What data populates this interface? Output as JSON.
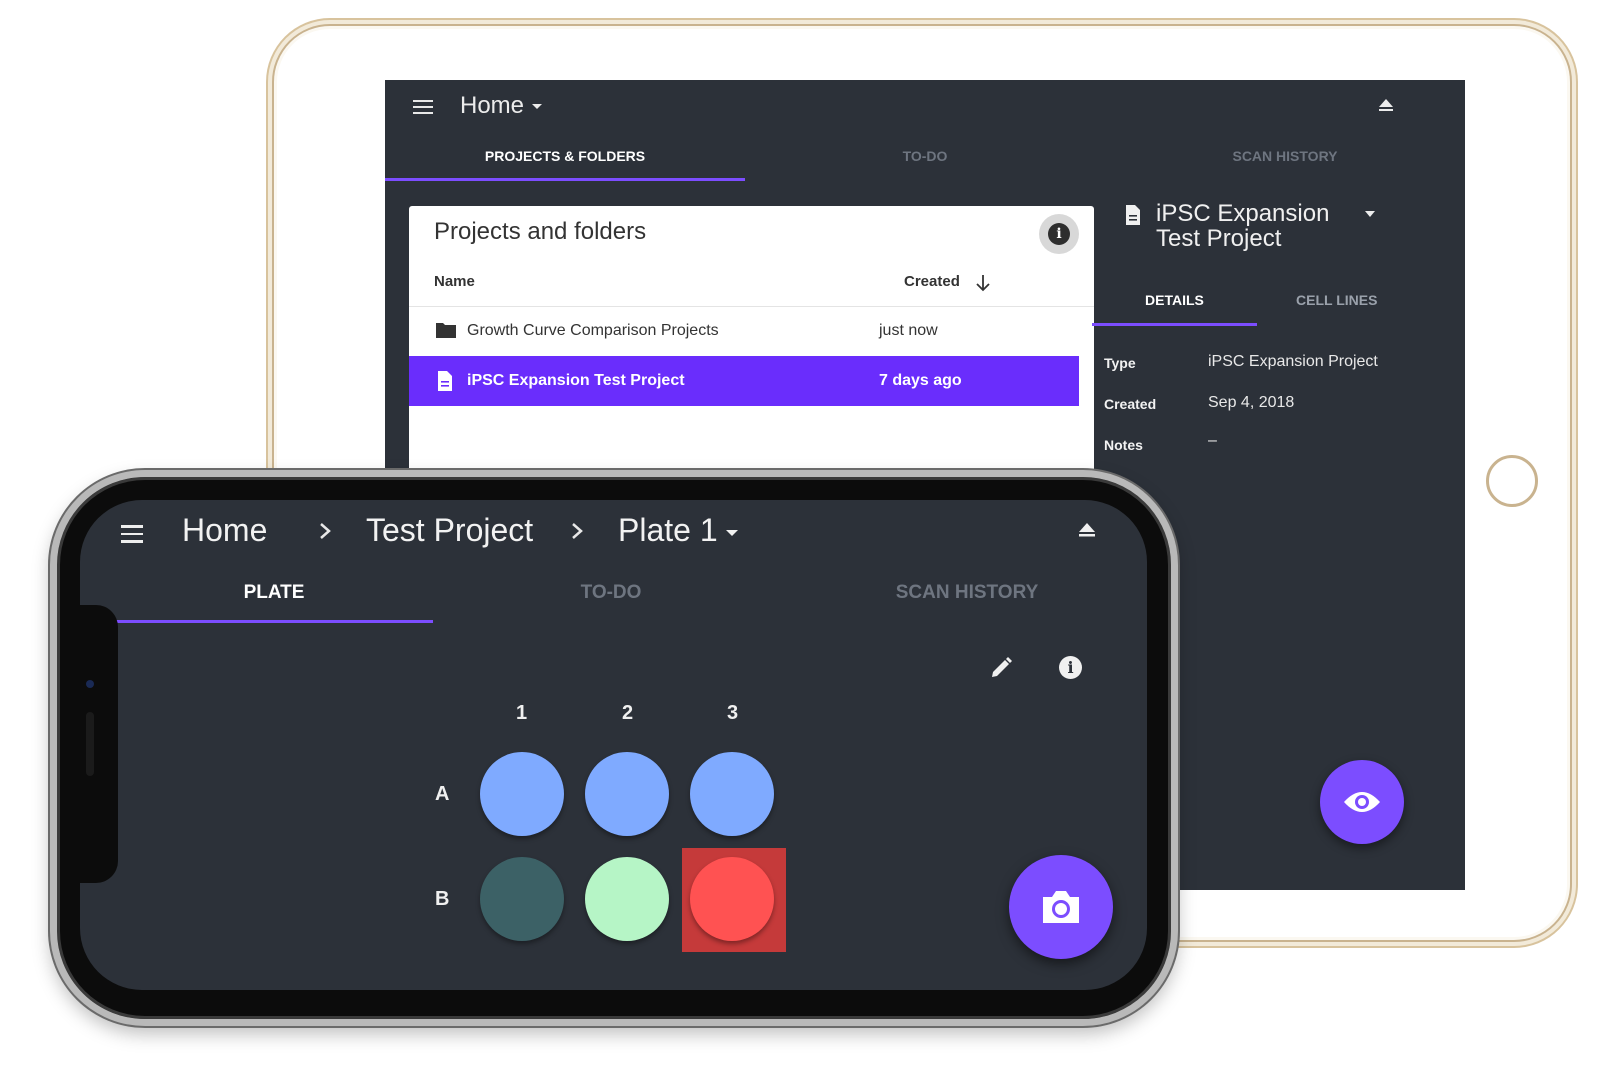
{
  "tablet": {
    "header": {
      "title": "Home"
    },
    "tabs": [
      {
        "label": "PROJECTS & FOLDERS",
        "active": true
      },
      {
        "label": "TO-DO",
        "active": false
      },
      {
        "label": "SCAN HISTORY",
        "active": false
      }
    ],
    "card": {
      "title": "Projects and folders",
      "columns": {
        "name": "Name",
        "created": "Created"
      },
      "rows": [
        {
          "icon": "folder-icon",
          "name": "Growth Curve Comparison Projects",
          "created": "just now",
          "selected": false
        },
        {
          "icon": "document-icon",
          "name": "iPSC Expansion Test Project",
          "created": "7 days ago",
          "selected": true
        }
      ]
    },
    "detail": {
      "title_line1": "iPSC Expansion",
      "title_line2": "Test Project",
      "tabs": [
        {
          "label": "DETAILS",
          "active": true
        },
        {
          "label": "CELL LINES",
          "active": false
        }
      ],
      "fields": [
        {
          "label": "Type",
          "value": "iPSC Expansion Project"
        },
        {
          "label": "Created",
          "value": "Sep 4, 2018"
        },
        {
          "label": "Notes",
          "value": "–"
        }
      ]
    }
  },
  "phone": {
    "breadcrumb": [
      "Home",
      "Test Project",
      "Plate 1"
    ],
    "tabs": [
      {
        "label": "PLATE",
        "active": true
      },
      {
        "label": "TO-DO",
        "active": false
      },
      {
        "label": "SCAN HISTORY",
        "active": false
      }
    ],
    "plate": {
      "columns": [
        "1",
        "2",
        "3"
      ],
      "rows": [
        "A",
        "B"
      ],
      "wells": [
        [
          "#7faaff",
          "#7faaff",
          "#7faaff"
        ],
        [
          "#3c6166",
          "#b6f5c6",
          "#ff5252"
        ]
      ],
      "selected_well": "B3"
    }
  },
  "colors": {
    "accent": "#7c4dff",
    "selected_row": "#6a2dfc",
    "screen_bg": "#2c3139"
  }
}
